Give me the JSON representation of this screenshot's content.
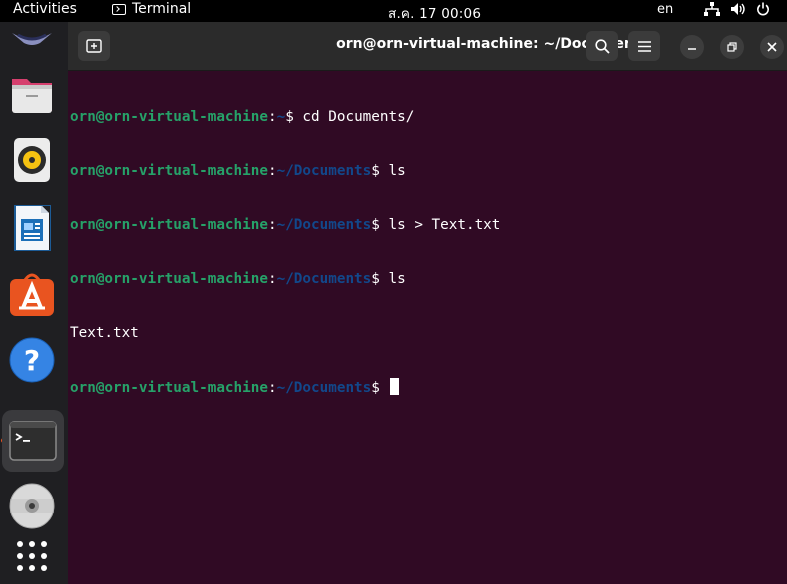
{
  "topbar": {
    "activities": "Activities",
    "app_name": "Terminal",
    "clock": "ส.ค. 17  00:06",
    "language": "en"
  },
  "dock": {
    "items": [
      {
        "name": "files-icon"
      },
      {
        "name": "rhythmbox-icon"
      },
      {
        "name": "libreoffice-writer-icon"
      },
      {
        "name": "ubuntu-software-icon"
      },
      {
        "name": "help-icon"
      },
      {
        "name": "terminal-icon",
        "active": true
      },
      {
        "name": "dvd-icon"
      },
      {
        "name": "show-apps-icon"
      }
    ]
  },
  "window": {
    "title": "orn@orn-virtual-machine: ~/Documents"
  },
  "terminal": {
    "lines": [
      {
        "user": "orn@orn-virtual-machine",
        "sep": ":",
        "path": "~",
        "prompt": "$ ",
        "cmd": "cd Documents/"
      },
      {
        "user": "orn@orn-virtual-machine",
        "sep": ":",
        "path": "~/Documents",
        "prompt": "$ ",
        "cmd": "ls"
      },
      {
        "user": "orn@orn-virtual-machine",
        "sep": ":",
        "path": "~/Documents",
        "prompt": "$ ",
        "cmd": "ls > Text.txt"
      },
      {
        "user": "orn@orn-virtual-machine",
        "sep": ":",
        "path": "~/Documents",
        "prompt": "$ ",
        "cmd": "ls"
      },
      {
        "output": "Text.txt"
      },
      {
        "user": "orn@orn-virtual-machine",
        "sep": ":",
        "path": "~/Documents",
        "prompt": "$ ",
        "cmd": ""
      }
    ]
  },
  "colors": {
    "terminal_bg": "#300a24",
    "user_green": "#26a269",
    "path_blue": "#12488b",
    "accent": "#e95420"
  }
}
